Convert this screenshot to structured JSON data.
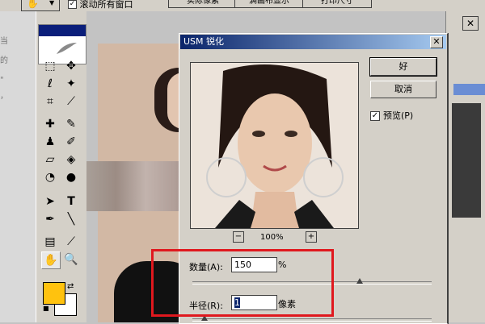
{
  "colors": {
    "accent_highlight": "#e0181e",
    "foreground_swatch": "#ffc20e",
    "titlebar": "#0a246a"
  },
  "options_bar": {
    "scroll_all_label": "滚动所有窗口",
    "buttons": [
      "实际像素",
      "满画布显示",
      "打印尺寸"
    ]
  },
  "left_fragments": [
    "当",
    "的",
    "\"",
    "，"
  ],
  "toolbox": {
    "tools": [
      "marquee-icon",
      "move-icon",
      "lasso-icon",
      "magic-wand-icon",
      "crop-icon",
      "slice-icon",
      "healing-brush-icon",
      "brush-icon",
      "clone-stamp-icon",
      "history-brush-icon",
      "eraser-icon",
      "paint-bucket-icon",
      "blur-icon",
      "dodge-icon",
      "path-select-icon",
      "type-icon",
      "pen-icon",
      "line-icon",
      "notes-icon",
      "eyedropper-icon",
      "hand-icon",
      "zoom-icon"
    ],
    "type_glyph": "T"
  },
  "dialog": {
    "title": "USM 锐化",
    "close_glyph": "✕",
    "ok_label": "好",
    "cancel_label": "取消",
    "preview_label": "预览(P)",
    "preview_checked": true,
    "zoom_level": "100%",
    "zoom_out": "−",
    "zoom_in": "+",
    "amount_label": "数量(A):",
    "amount_value": "150",
    "amount_unit": "%",
    "amount_slider_fraction": 0.7,
    "radius_label": "半径(R):",
    "radius_value": "1",
    "radius_unit": "像素",
    "radius_slider_fraction": 0.05
  }
}
